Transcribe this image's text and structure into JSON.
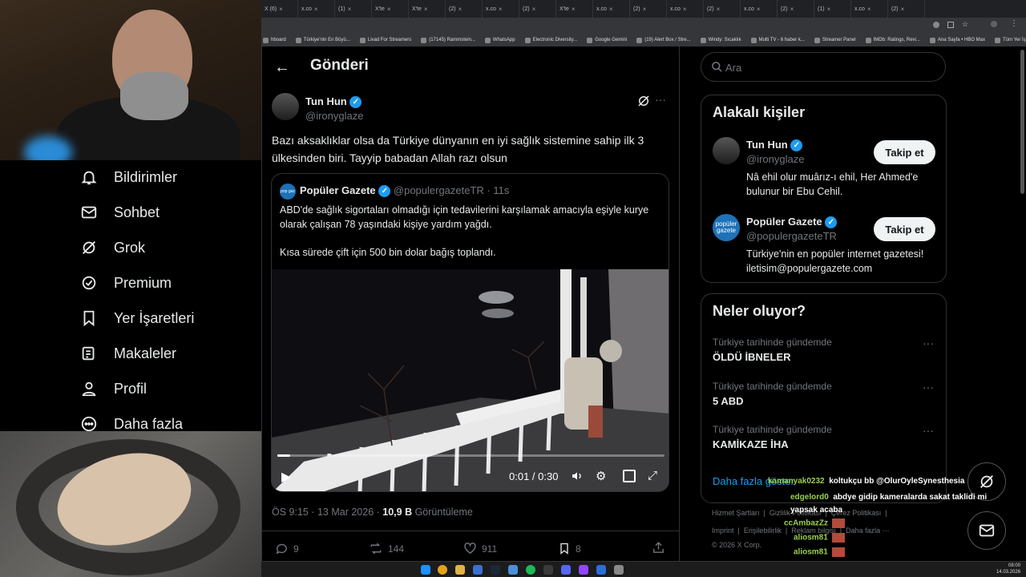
{
  "browser": {
    "tabs": [
      "X (6)",
      "x.co",
      "(1)",
      "X'te",
      "X'te",
      "(2)",
      "x.co",
      "(2)",
      "X'te",
      "x.co",
      "(2)",
      "x.co",
      "(2)",
      "x.co",
      "(2)",
      "(1)",
      "x.co",
      "(2)"
    ],
    "bookmarks": [
      "hboard",
      "Türkiye'nin En Büyü...",
      "Livad For Streamers",
      "(17145) Rammstein...",
      "WhatsApp",
      "Electronic Diversity...",
      "Google Gemini",
      "(19) Alert Box / Stre...",
      "Windy: Sıcaklık",
      "Multi TV - 6 haber k...",
      "Streamer Panel",
      "IMDb: Ratings, Revi...",
      "Ana Sayfa • HBO Max",
      "Tüm Yer İşaretleri"
    ]
  },
  "sidebar": {
    "items": [
      {
        "label": "Bildirimler",
        "icon": "bell-icon"
      },
      {
        "label": "Sohbet",
        "icon": "mail-icon"
      },
      {
        "label": "Grok",
        "icon": "grok-icon"
      },
      {
        "label": "Premium",
        "icon": "premium-icon"
      },
      {
        "label": "Yer İşaretleri",
        "icon": "bookmark-icon"
      },
      {
        "label": "Makaleler",
        "icon": "article-icon"
      },
      {
        "label": "Profil",
        "icon": "person-icon"
      },
      {
        "label": "Daha fazla",
        "icon": "more-circle-icon"
      }
    ]
  },
  "post": {
    "header_title": "Gönderi",
    "author_name": "Tun Hun",
    "author_handle": "@ironyglaze",
    "text": "Bazı aksaklıklar olsa da Türkiye dünyanın en iyi sağlık sistemine sahip ilk 3 ülkesinden biri. Tayyip babadan Allah razı olsun",
    "quote": {
      "author_name": "Popüler Gazete",
      "author_handle": "@populergazeteTR",
      "time": "· 11s",
      "text1": "ABD'de sağlık sigortaları olmadığı için tedavilerini karşılamak amacıyla eşiyle kurye olarak çalışan 78 yaşındaki kişiye yardım yağdı.",
      "text2": "Kısa sürede çift için 500 bin dolar bağış toplandı.",
      "video_time": "0:01 / 0:30",
      "video_progress": 0.033
    },
    "meta_time": "ÖS 9:15 · 13 Mar 2026 · ",
    "views_count": "10,9 B",
    "views_label": " Görüntüleme",
    "stats": {
      "replies": "9",
      "reposts": "144",
      "likes": "911",
      "bookmarks": "8"
    }
  },
  "right": {
    "search_placeholder": "Ara",
    "related_title": "Alakalı kişiler",
    "people": [
      {
        "name": "Tun Hun",
        "handle": "@ironyglaze",
        "bio": "Nâ ehil olur muârız-ı ehil, Her Ahmed'e bulunur bir Ebu Cehil.",
        "button": "Takip et"
      },
      {
        "name": "Popüler Gazete",
        "handle": "@populergazeteTR",
        "bio": "Türkiye'nin en popüler internet gazetesi! iletisim@populergazete.com",
        "button": "Takip et",
        "logo_text": "popüler gazete"
      }
    ],
    "trends_title": "Neler oluyor?",
    "trends": [
      {
        "category": "Türkiye tarihinde gündemde",
        "name": "ÖLDÜ İBNELER"
      },
      {
        "category": "Türkiye tarihinde gündemde",
        "name": "5 ABD"
      },
      {
        "category": "Türkiye tarihinde gündemde",
        "name": "KAMİKAZE İHA"
      }
    ],
    "show_more": "Daha fazla göster",
    "footer_row1": [
      "Hizmet Şartları",
      "Gizlilik Politikası",
      "Çerez Politikası"
    ],
    "footer_row2": [
      "Imprint",
      "Erişilebilirlik",
      "Reklam bilgisi",
      "Daha fazla ···"
    ],
    "copyright": "© 2026 X Corp."
  },
  "chat": [
    {
      "user": "kamanyak0232",
      "msg": "koltukçu bb @OlurOyleSynesthesia"
    },
    {
      "user": "edgelord0",
      "msg": "abdye gidip kameralarda sakat taklidi mi yapsak acaba"
    },
    {
      "user": "ccAmbazZz",
      "msg": ""
    },
    {
      "user": "aliosm81",
      "msg": ""
    },
    {
      "user": "aliosm81",
      "msg": ""
    },
    {
      "user": "aliosm81",
      "msg": ""
    }
  ],
  "taskbar": {
    "clock_time": "08:00",
    "clock_date": "14.03.2026"
  },
  "colors": {
    "accent": "#1d9bf0",
    "chat_user": "#9bd14b",
    "link": "#1d9bf0"
  }
}
